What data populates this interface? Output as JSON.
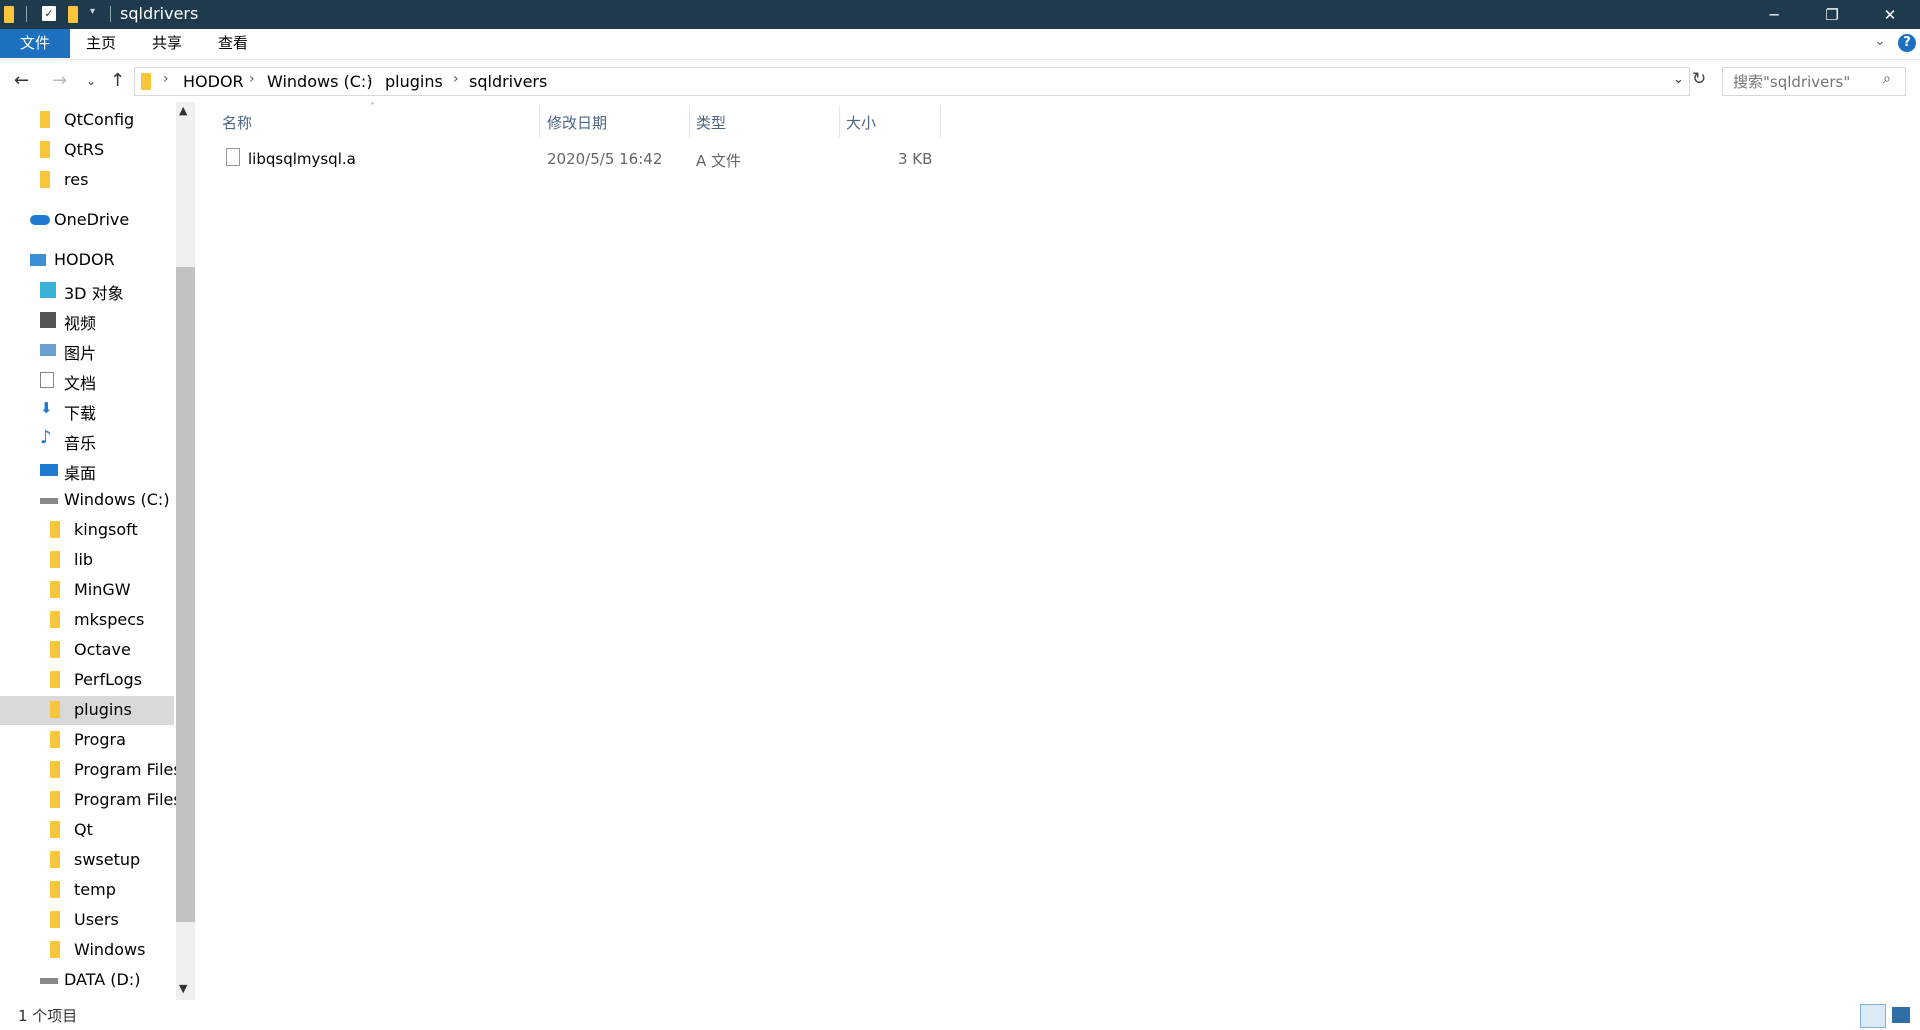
{
  "window": {
    "title": "sqldrivers"
  },
  "ribbon": {
    "tabs": [
      "文件",
      "主页",
      "共享",
      "查看"
    ]
  },
  "address": {
    "crumbs": [
      "HODOR",
      "Windows (C:)",
      "plugins",
      "sqldrivers"
    ]
  },
  "search": {
    "placeholder": "搜索\"sqldrivers\""
  },
  "sidebar": {
    "items": [
      {
        "label": "QtConfig",
        "icon": "folder-icon"
      },
      {
        "label": "QtRS",
        "icon": "folder-icon"
      },
      {
        "label": "res",
        "icon": "folder-icon"
      },
      {
        "label": "OneDrive",
        "icon": "cloud-icon"
      },
      {
        "label": "HODOR",
        "icon": "computer-icon"
      },
      {
        "label": "3D 对象",
        "icon": "cube-icon"
      },
      {
        "label": "视频",
        "icon": "video-icon"
      },
      {
        "label": "图片",
        "icon": "picture-icon"
      },
      {
        "label": "文档",
        "icon": "document-icon"
      },
      {
        "label": "下载",
        "icon": "download-icon"
      },
      {
        "label": "音乐",
        "icon": "music-icon"
      },
      {
        "label": "桌面",
        "icon": "desktop-icon"
      },
      {
        "label": "Windows (C:)",
        "icon": "drive-icon"
      },
      {
        "label": "kingsoft",
        "icon": "folder-icon"
      },
      {
        "label": "lib",
        "icon": "folder-icon"
      },
      {
        "label": "MinGW",
        "icon": "folder-icon"
      },
      {
        "label": "mkspecs",
        "icon": "folder-icon"
      },
      {
        "label": "Octave",
        "icon": "folder-icon"
      },
      {
        "label": "PerfLogs",
        "icon": "folder-icon"
      },
      {
        "label": "plugins",
        "icon": "folder-icon",
        "selected": true
      },
      {
        "label": "Progra",
        "icon": "folder-icon"
      },
      {
        "label": "Program Files",
        "icon": "folder-icon"
      },
      {
        "label": "Program Files",
        "icon": "folder-icon"
      },
      {
        "label": "Qt",
        "icon": "folder-icon"
      },
      {
        "label": "swsetup",
        "icon": "folder-icon"
      },
      {
        "label": "temp",
        "icon": "folder-icon"
      },
      {
        "label": "Users",
        "icon": "folder-icon"
      },
      {
        "label": "Windows",
        "icon": "folder-icon"
      },
      {
        "label": "DATA (D:)",
        "icon": "drive-icon"
      }
    ]
  },
  "columns": {
    "name": "名称",
    "modified": "修改日期",
    "type": "类型",
    "size": "大小"
  },
  "files": [
    {
      "name": "libqsqlmysql.a",
      "modified": "2020/5/5 16:42",
      "type": "A 文件",
      "size": "3 KB"
    }
  ],
  "status": {
    "count": "1 个项目"
  }
}
